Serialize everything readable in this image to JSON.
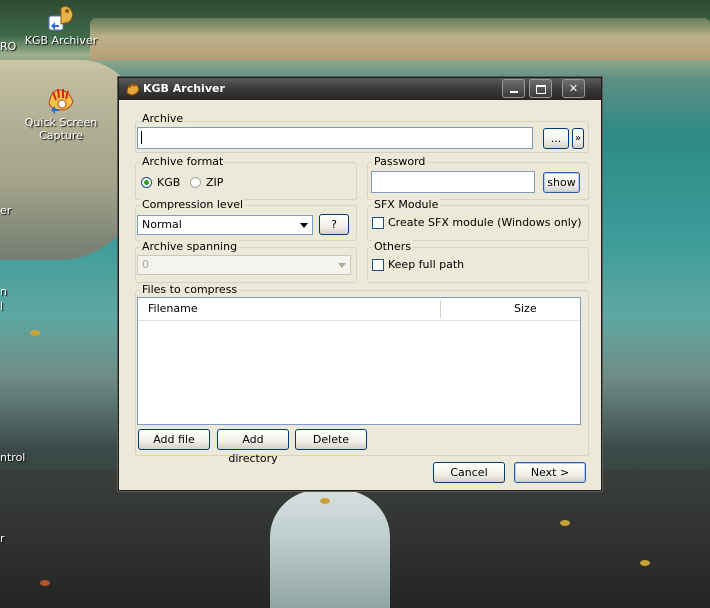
{
  "desktop": {
    "icons": [
      {
        "label": "KGB Archiver",
        "icon": "kgb-archiver-icon"
      },
      {
        "label": "Quick Screen Capture",
        "icon": "quick-screen-capture-icon"
      }
    ],
    "edge_labels": [
      "RO",
      "er",
      "n",
      "l",
      "ntrol",
      "r"
    ]
  },
  "window": {
    "title": "KGB Archiver",
    "title_icon": "kgb-paw-icon",
    "controls": {
      "minimize": "minimize-icon",
      "maximize": "maximize-icon",
      "close": "close-icon"
    }
  },
  "archive": {
    "label": "Archive",
    "value": "",
    "browse_label": "...",
    "more_label": "»"
  },
  "archive_format": {
    "label": "Archive format",
    "options": [
      {
        "label": "KGB",
        "selected": true
      },
      {
        "label": "ZIP",
        "selected": false
      }
    ]
  },
  "password": {
    "label": "Password",
    "value": "",
    "show_label": "show"
  },
  "compression": {
    "label": "Compression level",
    "value": "Normal",
    "help_label": "?"
  },
  "sfx": {
    "label": "SFX Module",
    "checkbox_label": "Create SFX module (Windows only)",
    "checked": false
  },
  "spanning": {
    "label": "Archive spanning",
    "value": "0"
  },
  "others": {
    "label": "Others",
    "checkbox_label": "Keep full path",
    "checked": false
  },
  "files": {
    "label": "Files to compress",
    "columns": [
      "Filename",
      "Size"
    ],
    "rows": [],
    "add_file_label": "Add file",
    "add_directory_label": "Add directory",
    "delete_label": "Delete"
  },
  "footer": {
    "cancel_label": "Cancel",
    "next_label": "Next >"
  }
}
